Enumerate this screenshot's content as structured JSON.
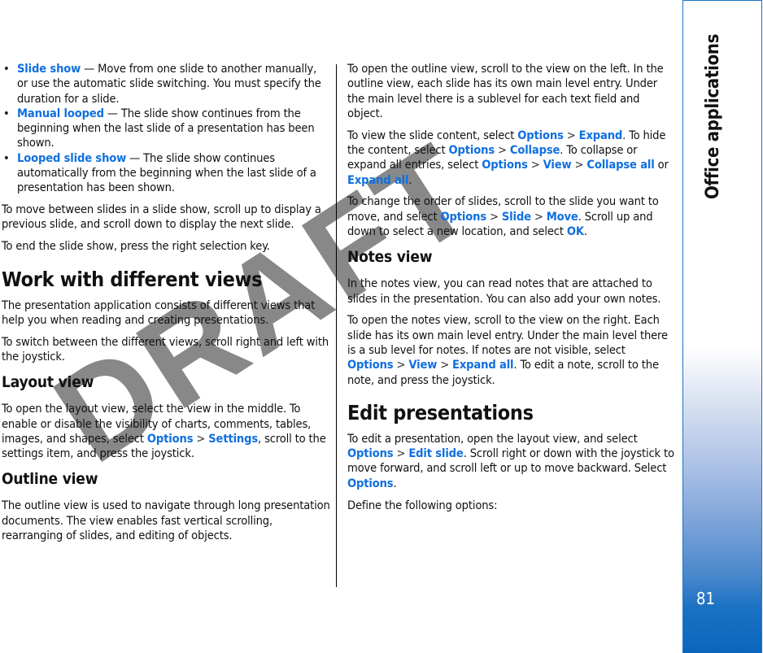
{
  "left_column": {
    "bullets": [
      {
        "term": "Slide show",
        "text": " — Move from one slide to another manually, or use the automatic slide switching. You must specify the duration for a slide."
      },
      {
        "term": "Manual looped",
        "text": " — The slide show continues from the beginning when the last slide of a presentation has been shown."
      },
      {
        "term": "Looped slide show",
        "text": " — The slide show continues automatically from the beginning when the last slide of a presentation has been shown."
      }
    ],
    "para_move": "To move between slides in a slide show, scroll up to display a previous slide, and scroll down to display the next slide.",
    "para_end": "To end the slide show, press the right selection key.",
    "heading_views": "Work with different views",
    "para_views_1": "The presentation application consists of different views that help you when reading and creating presentations.",
    "para_views_2": "To switch between the different views, scroll right and left with the joystick.",
    "heading_layout": "Layout view",
    "layout": {
      "text_before": "To open the layout view, select the view in the middle. To enable or disable the visibility of charts, comments, tables, images, and shapes, select ",
      "link_options": "Options",
      "separator": ">",
      "link_settings": "Settings",
      "text_after": ", scroll to the settings item, and press the joystick."
    },
    "heading_outline": "Outline view",
    "para_outline": "The outline view is used to navigate through long presentation documents. The view enables fast vertical scrolling, rearranging of slides, and editing of objects."
  },
  "right_column": {
    "para_outline_open": "To open the outline view, scroll to the view on the left. In the outline view, each slide has its own main level entry. Under the main level there is a sublevel for each text field and object.",
    "content": {
      "t1": "To view the slide content, select ",
      "options": "Options",
      "separator": ">",
      "expand": "Expand",
      "t2": ". To hide the content, select ",
      "collapse": "Collapse",
      "t3": ". To collapse or expand all entries, select ",
      "view": "View",
      "collapse_all": "Collapse all",
      "t4": " or ",
      "expand_all": "Expand all",
      "t5": "."
    },
    "order": {
      "t1": "To change the order of slides, scroll to the slide you want to move, and select ",
      "options": "Options",
      "separator": ">",
      "slide": "Slide",
      "move": "Move",
      "t2": ". Scroll up and down to select a new location, and select ",
      "ok": "OK",
      "t3": "."
    },
    "heading_notes": "Notes view",
    "para_notes_1": "In the notes view, you can read notes that are attached to slides in the presentation. You can also add your own notes.",
    "notes_open": {
      "t1": "To open the notes view, scroll to the view on the right. Each slide has its own main level entry. Under the main level there is a sub level for notes. If notes are not visible, select ",
      "options": "Options",
      "separator": ">",
      "view": "View",
      "expand_all": "Expand all",
      "t2": ". To edit a note, scroll to the note, and press the joystick."
    },
    "heading_edit": "Edit presentations",
    "edit": {
      "t1": "To edit a presentation, open the layout view, and select ",
      "options": "Options",
      "separator": ">",
      "edit_slide": "Edit slide",
      "t2": ". Scroll right or down with the joystick to move forward, and scroll left or up to move backward. Select ",
      "t3": "."
    },
    "para_define": "Define the following options:"
  },
  "sidebar": {
    "section_title": "Office applications",
    "page_number": "81"
  },
  "watermark": "DRAFT",
  "colors": {
    "link": "#0f6fdf",
    "sidebar_border": "#1a74c8",
    "sidebar_gradient_bottom": "#0a66bd"
  }
}
